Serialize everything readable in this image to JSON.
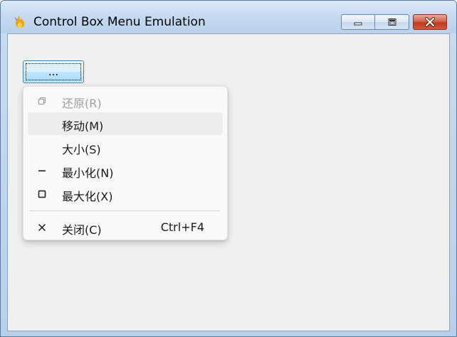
{
  "window": {
    "title": "Control Box Menu Emulation",
    "controls": {
      "minimize": "minimize",
      "maximize": "maximize",
      "close": "close"
    }
  },
  "button": {
    "label": "..."
  },
  "menu": {
    "items": [
      {
        "label": "还原(R)",
        "icon": "restore-icon",
        "enabled": false,
        "shortcut": ""
      },
      {
        "label": "移动(M)",
        "icon": "",
        "enabled": true,
        "highlighted": true,
        "shortcut": ""
      },
      {
        "label": "大小(S)",
        "icon": "",
        "enabled": true,
        "shortcut": ""
      },
      {
        "label": "最小化(N)",
        "icon": "minimize-icon",
        "enabled": true,
        "shortcut": ""
      },
      {
        "label": "最大化(X)",
        "icon": "maximize-icon",
        "enabled": true,
        "shortcut": ""
      },
      {
        "label": "关闭(C)",
        "icon": "close-icon",
        "enabled": true,
        "shortcut": "Ctrl+F4"
      }
    ]
  },
  "colors": {
    "titlebar": "#c6daf1",
    "close_button": "#c0391f",
    "client_background": "#f0f0f0",
    "menu_background": "#f9f9f9",
    "menu_hover": "#ededed",
    "button_focus_border": "#3c7fb1"
  }
}
